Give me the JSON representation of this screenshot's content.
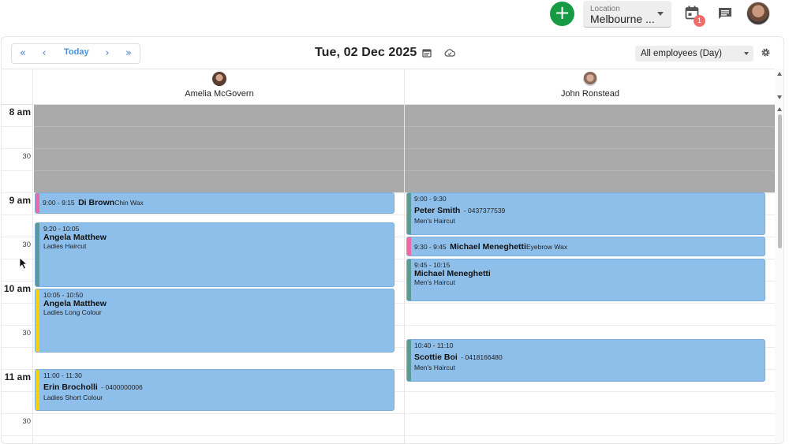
{
  "topbar": {
    "add_icon": "plus-icon",
    "location_label": "Location",
    "location_value": "Melbourne ...",
    "calendar_badge": "1",
    "calendar_icon": "calendar-icon",
    "chat_icon": "chat-icon",
    "accent": "#169a43",
    "badge_color": "#f26b6b"
  },
  "toolbar": {
    "first_label": "«",
    "prev_label": "‹",
    "today_label": "Today",
    "next_label": "›",
    "last_label": "»",
    "date_title": "Tue, 02 Dec 2025",
    "employee_filter": "All employees (Day)"
  },
  "time_labels": {
    "h8": "8 am",
    "h8_30": "30",
    "h9": "9 am",
    "h9_30": "30",
    "h10": "10 am",
    "h10_30": "30",
    "h11": "11 am",
    "h11_30": "30"
  },
  "employees": [
    {
      "name": "Amelia McGovern"
    },
    {
      "name": "John Ronstead"
    }
  ],
  "appointments": {
    "a1": {
      "time": "9:00 - 9:15",
      "client": "Di Brown",
      "extra": "Chin Wax",
      "service": "",
      "color": "#ee6aa7"
    },
    "a2": {
      "time": "9:20 - 10:05",
      "client": "Angela Matthew",
      "extra": "",
      "service": "Ladies Haircut",
      "color": "#5b9a95"
    },
    "a3": {
      "time": "10:05 - 10:50",
      "client": "Angela Matthew",
      "extra": "",
      "service": "Ladies Long Colour",
      "color": "#f5d10b"
    },
    "a4": {
      "time": "11:00 - 11:30",
      "client": "Erin Brocholli",
      "extra": "- 0400000006",
      "service": "Ladies Short Colour",
      "color": "#f5d10b"
    },
    "b1": {
      "time": "9:00 - 9:30",
      "client": "Peter Smith",
      "extra": "- 0437377539",
      "service": "Men's Haircut",
      "color": "#5b9a95"
    },
    "b2": {
      "time": "9:30 - 9:45",
      "client": "Michael Meneghetti",
      "extra": "Eyebrow Wax",
      "service": "",
      "color": "#ee6aa7"
    },
    "b3": {
      "time": "9:45 - 10:15",
      "client": "Michael Meneghetti",
      "extra": "",
      "service": "Men's Haircut",
      "color": "#5b9a95"
    },
    "b4": {
      "time": "10:40 - 11:10",
      "client": "Scottie Boi",
      "extra": "- 0418166480",
      "service": "Men's Haircut",
      "color": "#5b9a95"
    }
  }
}
